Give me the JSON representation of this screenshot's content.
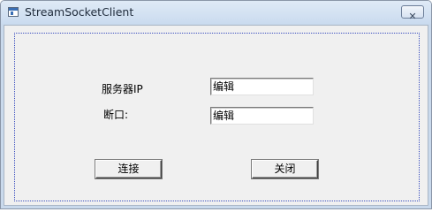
{
  "window": {
    "title": "StreamSocketClient",
    "close_glyph": "✕"
  },
  "form": {
    "server_ip_label": "服务器IP",
    "server_ip_value": "编辑",
    "port_label": "断口:",
    "port_value": "编辑"
  },
  "buttons": {
    "connect_label": "连接",
    "close_label": "关闭"
  }
}
